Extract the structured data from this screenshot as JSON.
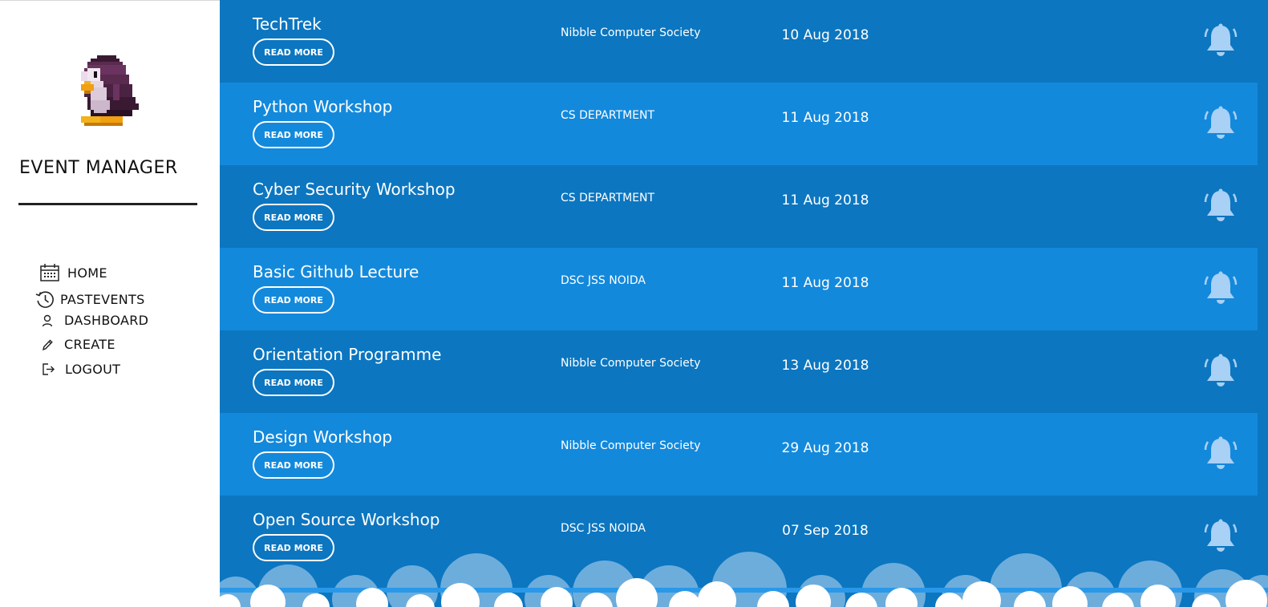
{
  "sidebar": {
    "title": "EVENT MANAGER",
    "nav": [
      {
        "label": "HOME",
        "icon": "calendar-icon"
      },
      {
        "label": "PASTEVENTS",
        "icon": "history-icon"
      },
      {
        "label": "DASHBOARD",
        "icon": "user-icon"
      },
      {
        "label": "CREATE",
        "icon": "pencil-icon"
      },
      {
        "label": "LOGOUT",
        "icon": "logout-icon"
      }
    ]
  },
  "events": [
    {
      "name": "TechTrek",
      "button": "READ MORE",
      "organizer": "Nibble Computer Society",
      "date": "10 Aug 2018"
    },
    {
      "name": "Python Workshop",
      "button": "READ MORE",
      "organizer": "CS DEPARTMENT",
      "date": "11 Aug 2018"
    },
    {
      "name": "Cyber Security Workshop",
      "button": "READ MORE",
      "organizer": "CS DEPARTMENT",
      "date": "11 Aug 2018"
    },
    {
      "name": "Basic Github Lecture",
      "button": "READ MORE",
      "organizer": "DSC JSS NOIDA",
      "date": "11 Aug 2018"
    },
    {
      "name": "Orientation Programme",
      "button": "READ MORE",
      "organizer": "Nibble Computer Society",
      "date": "13 Aug 2018"
    },
    {
      "name": "Design Workshop",
      "button": "READ MORE",
      "organizer": "Nibble Computer Society",
      "date": "29 Aug 2018"
    },
    {
      "name": "Open Source Workshop",
      "button": "READ MORE",
      "organizer": "DSC JSS NOIDA",
      "date": "07 Sep 2018"
    }
  ],
  "colors": {
    "row_dark": "#0c76c0",
    "row_light": "#1389dc",
    "bell": "#a9d0f5",
    "text_on_blue": "#ffffff",
    "sidebar_text": "#111111"
  }
}
